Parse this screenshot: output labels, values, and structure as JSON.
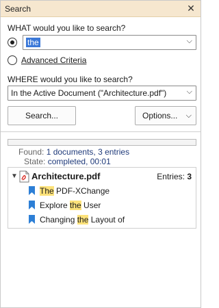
{
  "window": {
    "title": "Search"
  },
  "what": {
    "label": "WHAT would you like to search?",
    "query": "the",
    "advanced_label": "Advanced Criteria"
  },
  "where": {
    "label": "WHERE would you like to search?",
    "value": "In the Active Document (\"Architecture.pdf\")"
  },
  "buttons": {
    "search": "Search...",
    "options": "Options..."
  },
  "status": {
    "found_label": "Found:",
    "found_value": "1 documents, 3 entries",
    "state_label": "State:",
    "state_value": "completed, 00:01"
  },
  "results": {
    "file_name": "Architecture.pdf",
    "entries_label": "Entries:",
    "entries_count": "3",
    "items": [
      {
        "highlight": "The",
        "rest": " PDF-XChange",
        "prefix": ""
      },
      {
        "prefix": "Explore ",
        "highlight": "the",
        "rest": " User"
      },
      {
        "prefix": "Changing ",
        "highlight": "the",
        "rest": " Layout of"
      }
    ]
  },
  "icons": {
    "close": "close-icon",
    "chevron": "chevron-down-icon",
    "file": "pdf-file-icon",
    "bookmark": "bookmark-icon"
  },
  "colors": {
    "titlebar": "#f6e7cf",
    "highlight": "#fde27a",
    "selection": "#3b78d8",
    "bookmark": "#2d7fd6",
    "status_value": "#1f3a7a"
  }
}
